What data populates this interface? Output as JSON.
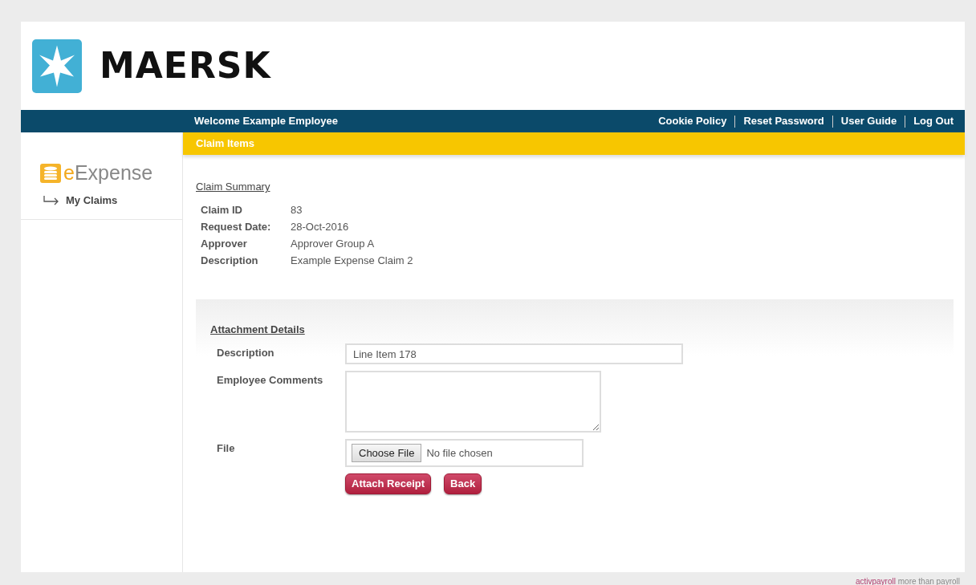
{
  "brand": {
    "name": "MAERSK"
  },
  "nav": {
    "welcome": "Welcome Example Employee",
    "links": [
      "Cookie Policy",
      "Reset Password",
      "User Guide",
      "Log Out"
    ]
  },
  "sidebar": {
    "app_logo": {
      "prefix": "e",
      "name": "Expense"
    },
    "items": [
      {
        "label": "My Claims",
        "selected": false
      }
    ]
  },
  "section_bar": {
    "title": "Claim Items"
  },
  "claim_summary": {
    "heading": "Claim Summary",
    "fields": [
      {
        "label": "Claim ID",
        "value": "83"
      },
      {
        "label": "Request Date:",
        "value": "28-Oct-2016"
      },
      {
        "label": "Approver",
        "value": "Approver Group A"
      },
      {
        "label": "Description",
        "value": "Example Expense Claim 2"
      }
    ]
  },
  "attachment": {
    "heading": "Attachment Details",
    "description": {
      "label": "Description",
      "value": "Line Item 178"
    },
    "comments": {
      "label": "Employee Comments"
    },
    "file": {
      "label": "File",
      "button": "Choose File",
      "status": "No file chosen"
    },
    "buttons": [
      "Attach Receipt",
      "Back"
    ]
  },
  "footer": {
    "brand": "activpayroll",
    "tagline": "more than payroll"
  }
}
